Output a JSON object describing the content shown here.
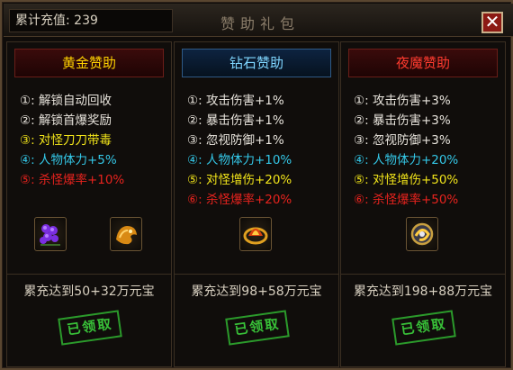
{
  "header": {
    "recharge_label": "累计充值:",
    "recharge_value": "239",
    "title": "赞助礼包",
    "close_icon": "close-icon"
  },
  "tiers": [
    {
      "name": "黄金赞助",
      "name_color": "#ffd200",
      "perks": [
        {
          "text": "①: 解锁自动回收",
          "color": "#e8e4dc"
        },
        {
          "text": "②: 解锁首爆奖励",
          "color": "#e8e4dc"
        },
        {
          "text": "③: 对怪刀刀带毒",
          "color": "#f2e51a"
        },
        {
          "text": "④: 人物体力+5%",
          "color": "#34c8e8"
        },
        {
          "text": "⑤: 杀怪爆率+10%",
          "color": "#e8231e"
        }
      ],
      "icons": [
        "purple-gem-cluster-icon",
        "golden-beast-icon"
      ],
      "requirement": "累充达到50+32万元宝",
      "status": "已领取"
    },
    {
      "name": "钻石赞助",
      "name_color": "#7fd6ff",
      "perks": [
        {
          "text": "①: 攻击伤害+1%",
          "color": "#e8e4dc"
        },
        {
          "text": "②: 暴击伤害+1%",
          "color": "#e8e4dc"
        },
        {
          "text": "③: 忽视防御+1%",
          "color": "#e8e4dc"
        },
        {
          "text": "④: 人物体力+10%",
          "color": "#34c8e8"
        },
        {
          "text": "⑤: 对怪增伤+20%",
          "color": "#f2e51a"
        },
        {
          "text": "⑥: 杀怪爆率+20%",
          "color": "#e8231e"
        }
      ],
      "icons": [
        "fire-ring-icon"
      ],
      "requirement": "累充达到98+58万元宝",
      "status": "已领取"
    },
    {
      "name": "夜魔赞助",
      "name_color": "#ff3b2f",
      "perks": [
        {
          "text": "①: 攻击伤害+3%",
          "color": "#e8e4dc"
        },
        {
          "text": "②: 暴击伤害+3%",
          "color": "#e8e4dc"
        },
        {
          "text": "③: 忽视防御+3%",
          "color": "#e8e4dc"
        },
        {
          "text": "④: 人物体力+20%",
          "color": "#34c8e8"
        },
        {
          "text": "⑤: 对怪增伤+50%",
          "color": "#f2e51a"
        },
        {
          "text": "⑥: 杀怪爆率+50%",
          "color": "#e8231e"
        }
      ],
      "icons": [
        "golden-orb-icon"
      ],
      "requirement": "累充达到198+88万元宝",
      "status": "已领取"
    }
  ]
}
